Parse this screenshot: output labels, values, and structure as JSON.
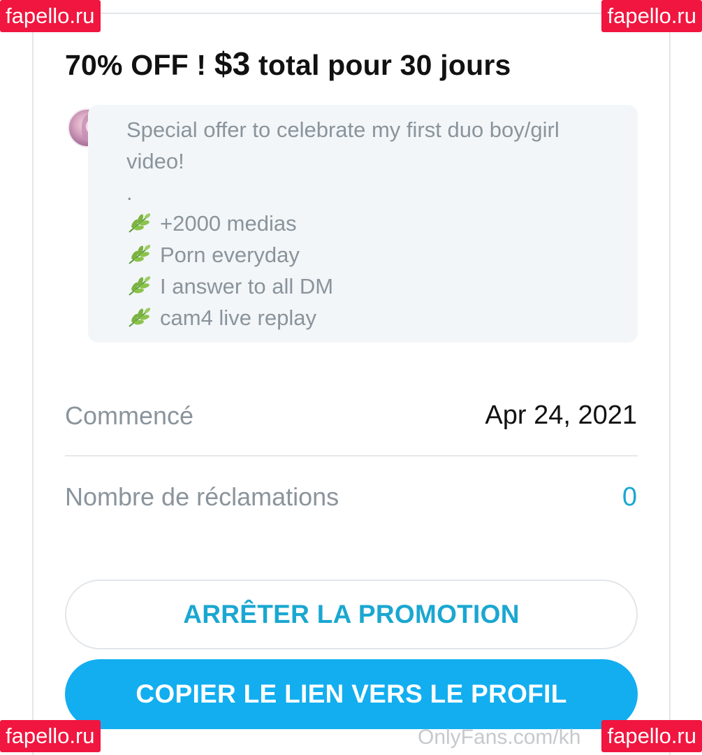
{
  "promo": {
    "title_prefix": "70% OFF ! ",
    "title_price": "$3",
    "title_suffix": " total pour 30 jours",
    "message": {
      "line1": "Special offer to celebrate my first duo boy/girl",
      "line2": "video!",
      "line3": ".",
      "bullets": [
        "+2000 medias",
        "Porn everyday",
        "I answer to all DM",
        "cam4 live replay"
      ]
    }
  },
  "details": {
    "started_label": "Commencé",
    "started_value": "Apr 24, 2021",
    "claims_label": "Nombre de réclamations",
    "claims_value": "0"
  },
  "actions": {
    "stop_label": "ARRÊTER LA PROMOTION",
    "copy_label": "COPIER LE LIEN VERS LE PROFIL"
  },
  "watermark": {
    "text": "OnlyFans.com/kh"
  },
  "overlay": {
    "site_label": "fapello.ru"
  },
  "colors": {
    "accent": "#1aa7d1",
    "primary_button": "#12aef0",
    "badge": "#f0163f"
  },
  "icons": {
    "bullet": "herb-leaf-icon"
  }
}
